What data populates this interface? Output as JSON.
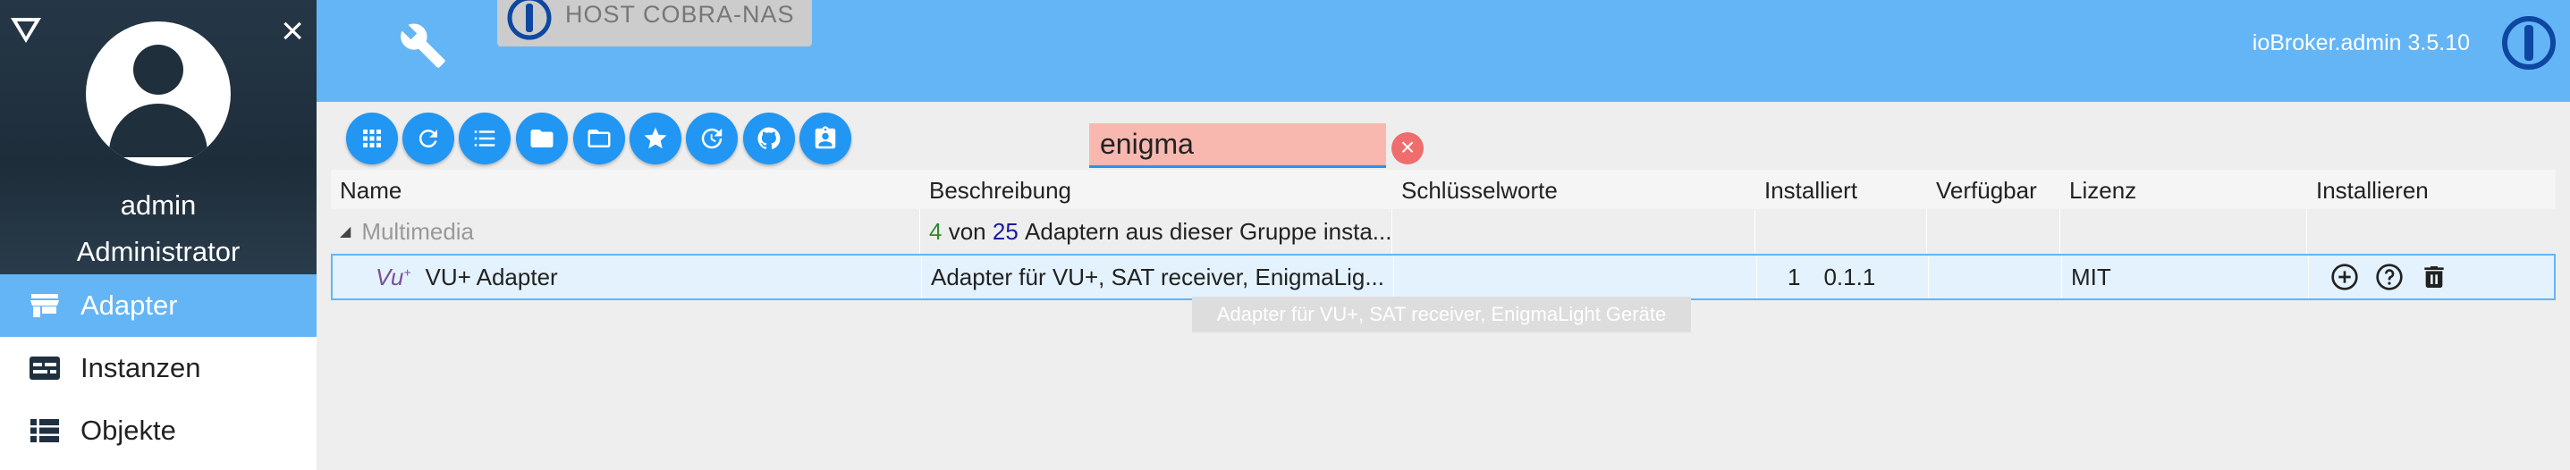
{
  "sidebar": {
    "user_name": "admin",
    "user_role": "Administrator",
    "close_icon": "×",
    "items": [
      {
        "label": "Adapter",
        "icon": "store-icon",
        "active": true
      },
      {
        "label": "Instanzen",
        "icon": "instances-icon",
        "active": false
      },
      {
        "label": "Objekte",
        "icon": "list-icon",
        "active": false
      }
    ]
  },
  "header": {
    "host_label": "HOST COBRA-NAS",
    "version": "ioBroker.admin 3.5.10",
    "accent_color": "#64b5f6"
  },
  "toolbar": {
    "buttons": [
      "grid-icon",
      "refresh-icon",
      "list-icon",
      "folder-icon",
      "folder-open-icon",
      "star-icon",
      "update-icon",
      "github-icon",
      "badge-icon"
    ],
    "search_value": "enigma",
    "clear_icon": "×"
  },
  "table": {
    "columns": [
      "Name",
      "Beschreibung",
      "Schlüsselworte",
      "Installiert",
      "Verfügbar",
      "Lizenz",
      "Installieren"
    ],
    "group": {
      "name": "Multimedia",
      "installed": "4",
      "von": "von",
      "total": "25",
      "rest": "Adaptern aus dieser Gruppe insta..."
    },
    "rows": [
      {
        "name": "VU+ Adapter",
        "description": "Adapter für VU+, SAT receiver, EnigmaLig...",
        "keywords": "",
        "installed_count": "1",
        "installed_version": "0.1.1",
        "available": "",
        "license": "MIT",
        "actions": [
          "add-instance-icon",
          "help-icon",
          "delete-icon"
        ]
      }
    ],
    "tooltip": "Adapter für VU+, SAT receiver, EnigmaLight Geräte"
  }
}
